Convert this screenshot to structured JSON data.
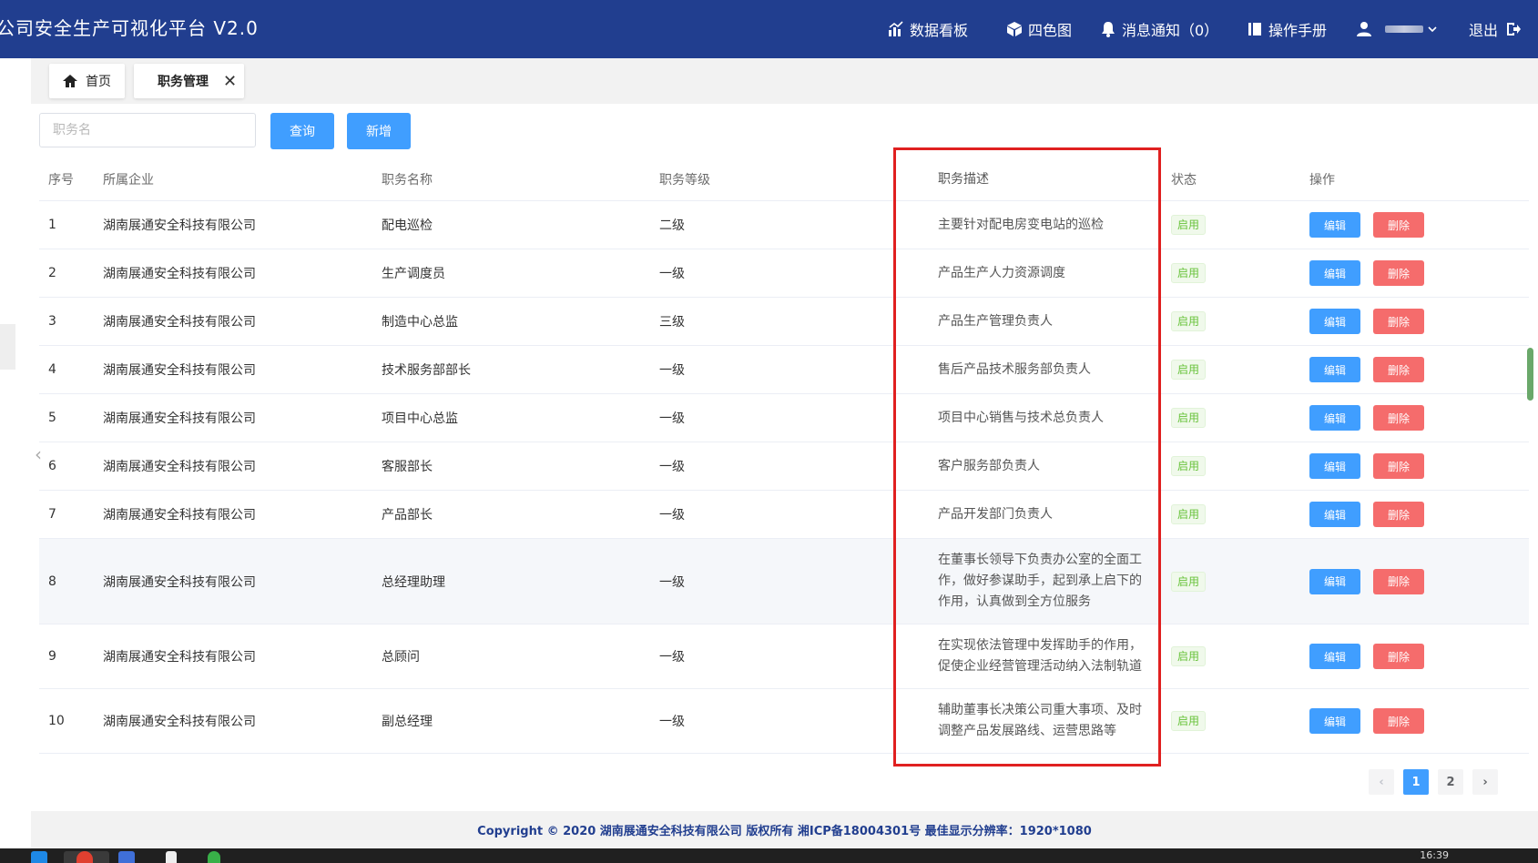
{
  "app": {
    "title": "公司安全生产可视化平台 V2.0"
  },
  "nav": {
    "dashboard": "数据看板",
    "four_color_map": "四色图",
    "notifications": "消息通知（0）",
    "manual": "操作手册",
    "logout": "退出"
  },
  "tabs": {
    "home": "首页",
    "duty_mgmt": "职务管理"
  },
  "search": {
    "placeholder": "职务名",
    "query_label": "查询",
    "add_label": "新增"
  },
  "table": {
    "headers": {
      "seq": "序号",
      "enterprise": "所属企业",
      "name": "职务名称",
      "level": "职务等级",
      "desc": "职务描述",
      "status": "状态",
      "ops": "操作"
    },
    "edit_label": "编辑",
    "delete_label": "删除",
    "rows": [
      {
        "seq": "1",
        "enterprise": "湖南展通安全科技有限公司",
        "name": "配电巡检",
        "level": "二级",
        "desc": "主要针对配电房变电站的巡检",
        "status": "启用"
      },
      {
        "seq": "2",
        "enterprise": "湖南展通安全科技有限公司",
        "name": "生产调度员",
        "level": "一级",
        "desc": "产品生产人力资源调度",
        "status": "启用"
      },
      {
        "seq": "3",
        "enterprise": "湖南展通安全科技有限公司",
        "name": "制造中心总监",
        "level": "三级",
        "desc": "产品生产管理负责人",
        "status": "启用"
      },
      {
        "seq": "4",
        "enterprise": "湖南展通安全科技有限公司",
        "name": "技术服务部部长",
        "level": "一级",
        "desc": "售后产品技术服务部负责人",
        "status": "启用"
      },
      {
        "seq": "5",
        "enterprise": "湖南展通安全科技有限公司",
        "name": "项目中心总监",
        "level": "一级",
        "desc": "项目中心销售与技术总负责人",
        "status": "启用"
      },
      {
        "seq": "6",
        "enterprise": "湖南展通安全科技有限公司",
        "name": "客服部长",
        "level": "一级",
        "desc": "客户服务部负责人",
        "status": "启用"
      },
      {
        "seq": "7",
        "enterprise": "湖南展通安全科技有限公司",
        "name": "产品部长",
        "level": "一级",
        "desc": "产品开发部门负责人",
        "status": "启用"
      },
      {
        "seq": "8",
        "enterprise": "湖南展通安全科技有限公司",
        "name": "总经理助理",
        "level": "一级",
        "desc": "在董事长领导下负责办公室的全面工作，做好参谋助手，起到承上启下的作用，认真做到全方位服务",
        "status": "启用"
      },
      {
        "seq": "9",
        "enterprise": "湖南展通安全科技有限公司",
        "name": "总顾问",
        "level": "一级",
        "desc": "在实现依法管理中发挥助手的作用，促使企业经营管理活动纳入法制轨道",
        "status": "启用"
      },
      {
        "seq": "10",
        "enterprise": "湖南展通安全科技有限公司",
        "name": "副总经理",
        "level": "一级",
        "desc": "辅助董事长决策公司重大事项、及时调整产品发展路线、运营思路等",
        "status": "启用"
      }
    ]
  },
  "pagination": {
    "prev": "‹",
    "pages": [
      "1",
      "2"
    ],
    "current": "1",
    "next": "›"
  },
  "footer": {
    "text": "Copyright © 2020 湖南展通安全科技有限公司 版权所有 湘ICP备18004301号 最佳显示分辨率：1920*1080"
  },
  "taskbar": {
    "clock": "16:39"
  },
  "colors": {
    "header_bg": "#213e8f",
    "primary": "#409eff",
    "danger": "#f56c6c",
    "success": "#67c23a",
    "highlight": "#e02020"
  }
}
